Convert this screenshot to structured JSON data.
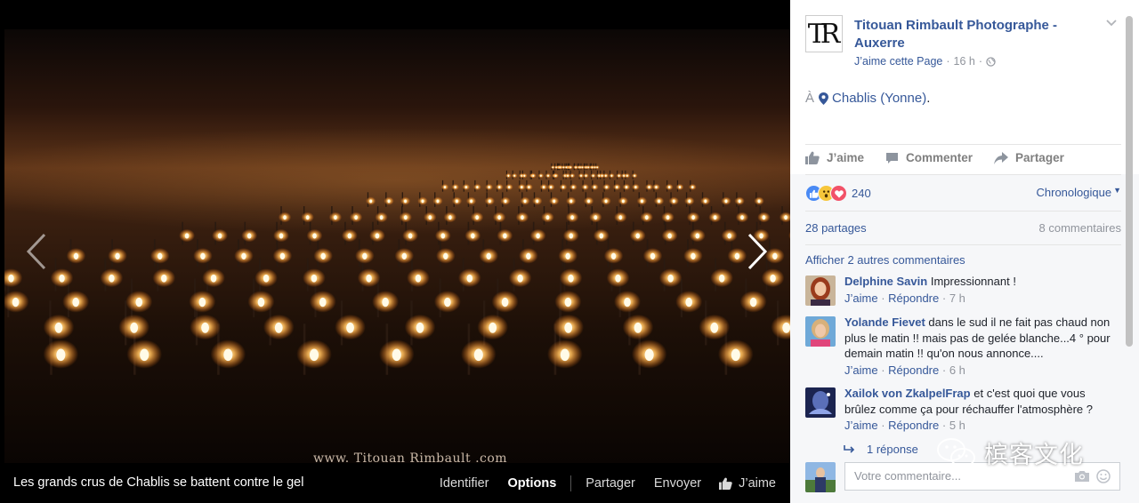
{
  "viewer": {
    "watermark": "www. Titouan Rimbault .com",
    "caption": "Les grands crus de Chablis se battent contre le gel",
    "actions": {
      "identify": "Identifier",
      "options": "Options",
      "share": "Partager",
      "send": "Envoyer",
      "like": "J’aime"
    }
  },
  "post": {
    "page_name": "Titouan Rimbault Photographe - Auxerre",
    "logo_text": "TR",
    "like_page": "J’aime cette Page",
    "time": "16 h",
    "location_prefix": "À",
    "location": "Chablis (Yonne)",
    "location_suffix": ".",
    "actions": {
      "like": "J’aime",
      "comment": "Commenter",
      "share": "Partager"
    },
    "reactions_count": "240",
    "sort": "Chronologique",
    "shares": "28 partages",
    "comments_count": "8 commentaires",
    "more_comments": "Afficher 2 autres commentaires",
    "comments": [
      {
        "author": "Delphine Savin",
        "text": "Impressionnant !",
        "like": "J’aime",
        "reply": "Répondre",
        "time": "7 h"
      },
      {
        "author": "Yolande Fievet",
        "text": "dans le sud il ne fait pas chaud non plus le matin !! mais pas de gelée blanche...4 ° pour demain matin !! qu'on nous annonce....",
        "like": "J’aime",
        "reply": "Répondre",
        "time": "6 h"
      },
      {
        "author": "Xailok von ZkalpelFrap",
        "text": "et c'est quoi que vous brûlez comme ça pour réchauffer l'atmosphère ?",
        "like": "J’aime",
        "reply": "Répondre",
        "time": "5 h"
      }
    ],
    "reply_link": "1 réponse",
    "compose_placeholder": "Votre commentaire..."
  },
  "brand": {
    "text": "槟客文化"
  },
  "colors": {
    "link": "#365899",
    "muted": "#90949c",
    "fire": "#ffb347"
  }
}
